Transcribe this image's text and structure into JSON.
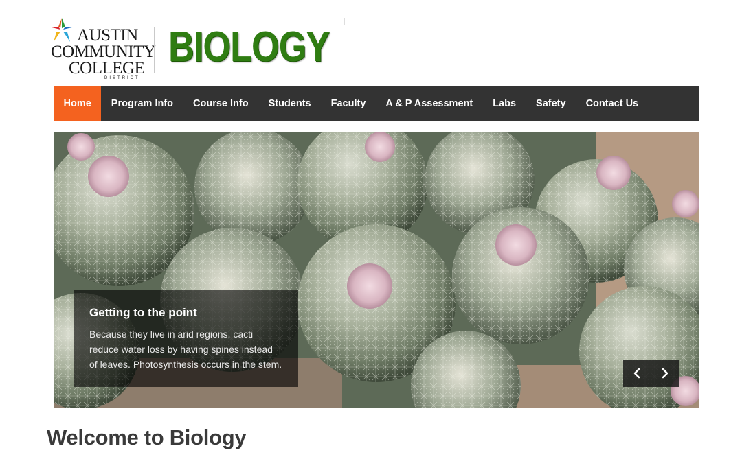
{
  "header": {
    "college_lines": [
      "AUSTIN",
      "COMMUNITY",
      "COLLEGE"
    ],
    "college_district": "DISTRICT",
    "site_title": "BIOLOGY"
  },
  "nav": {
    "items": [
      {
        "label": "Home",
        "active": true
      },
      {
        "label": "Program Info"
      },
      {
        "label": "Course Info"
      },
      {
        "label": "Students"
      },
      {
        "label": "Faculty"
      },
      {
        "label": "A & P Assessment"
      },
      {
        "label": "Labs"
      },
      {
        "label": "Safety"
      },
      {
        "label": "Contact Us"
      }
    ]
  },
  "slider": {
    "caption_title": "Getting to the point",
    "caption_text": "Because they live in arid regions, cacti reduce water loss by having spines instead of leaves. Photosynthesis occurs in the stem.",
    "prev_icon": "chevron-left-icon",
    "next_icon": "chevron-right-icon"
  },
  "main": {
    "heading": "Welcome to Biology"
  },
  "colors": {
    "nav_bg": "#333333",
    "nav_active": "#f4621f",
    "title_green": "#2f7d12"
  }
}
